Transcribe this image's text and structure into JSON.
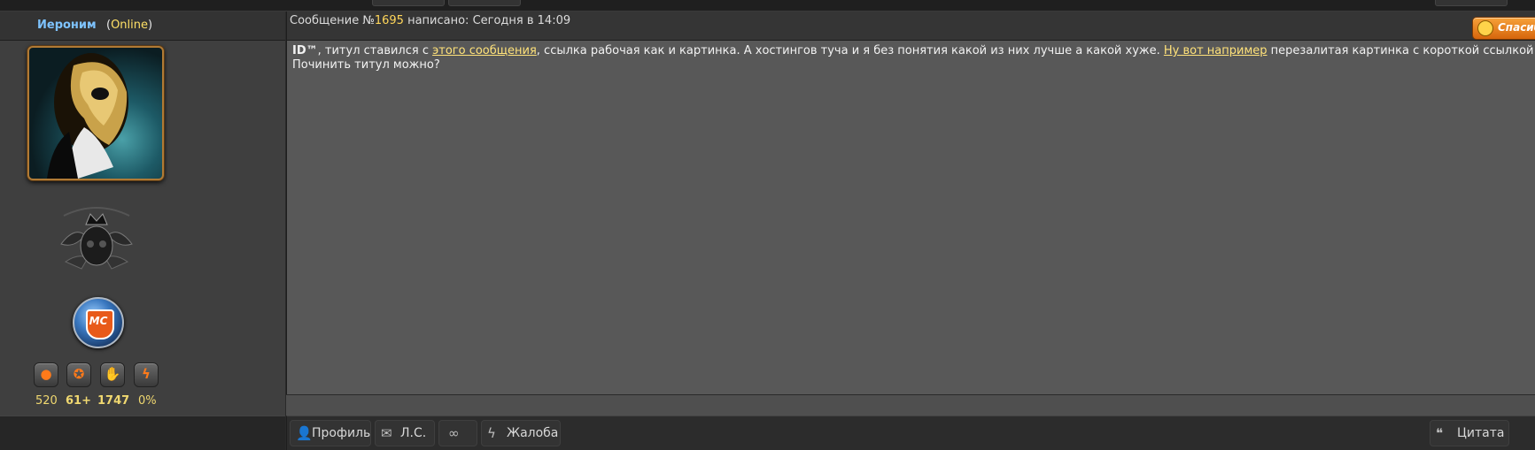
{
  "header": {
    "username": "Иероним",
    "status_open": "(",
    "status": "Online",
    "status_close": ")",
    "meta_prefix": "Сообщение №",
    "message_number": "1695",
    "meta_suffix": " написано: Сегодня в 14:09",
    "thanks_label": "Спасибо"
  },
  "user": {
    "stats": [
      {
        "icon": "speech-bubble-icon",
        "value": "520"
      },
      {
        "icon": "medal-icon",
        "value": "61+"
      },
      {
        "icon": "thumbs-up-icon",
        "value": "1747"
      },
      {
        "icon": "lightning-icon",
        "value": "0%"
      }
    ],
    "badge_text": "MC"
  },
  "message": {
    "nick": "ID™",
    "part1": ", титул ставился с ",
    "link1": "этого сообщения",
    "part2": ", ссылка рабочая как и картинка. А хостингов туча и я без понятия какой из них лучше а какой хуже. ",
    "link2": "Ну вот например",
    "part3": " перезалитая картинка с короткой ссылкой",
    "line2": "Починить титул можно?"
  },
  "footer": {
    "profile": "Профиль",
    "pm": "Л.С.",
    "link_icon": "link-icon",
    "complaint": "Жалоба",
    "quote": "Цитата"
  },
  "colors": {
    "username": "#7ec3ff",
    "online": "#ffe066",
    "link": "#ffe27a",
    "accent": "#ff7a1a",
    "content_bg": "#585858",
    "panel_bg": "#3f3f3f"
  }
}
